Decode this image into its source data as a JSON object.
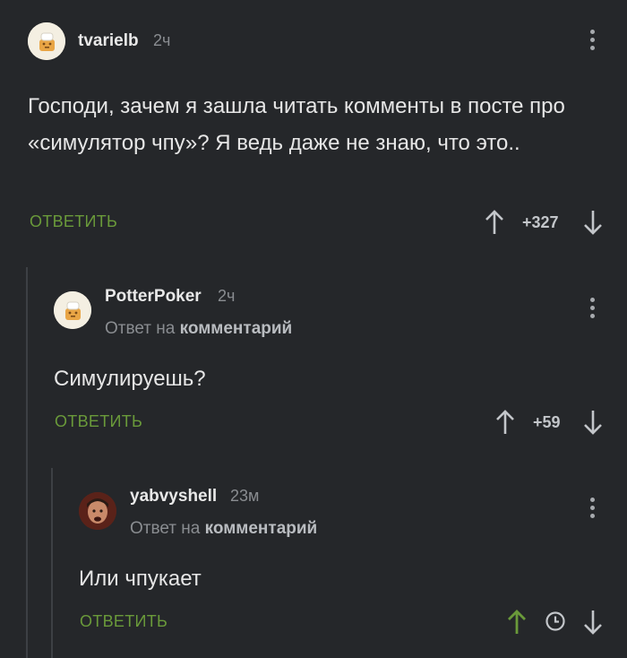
{
  "comments": [
    {
      "author": "tvarielb",
      "time": "2ч",
      "text": "Господи, зачем я зашла читать комменты в посте про «симулятор чпу»? Я ведь даже не знаю, что это..",
      "reply_label": "ОТВЕТИТЬ",
      "score": "+327"
    },
    {
      "author": "PotterPoker",
      "time": "2ч",
      "reply_prefix": "Ответ на",
      "reply_target": "комментарий",
      "text": "Симулируешь?",
      "reply_label": "ОТВЕТИТЬ",
      "score": "+59"
    },
    {
      "author": "yabvyshell",
      "time": "23м",
      "reply_prefix": "Ответ на",
      "reply_target": "комментарий",
      "text": "Или чпукает",
      "reply_label": "ОТВЕТИТЬ",
      "score_icon": "clock-icon"
    }
  ],
  "colors": {
    "background": "#25272a",
    "reply_green": "#6a9a3a",
    "upvoted_green": "#6a9a3a",
    "muted": "#8a8d91"
  }
}
